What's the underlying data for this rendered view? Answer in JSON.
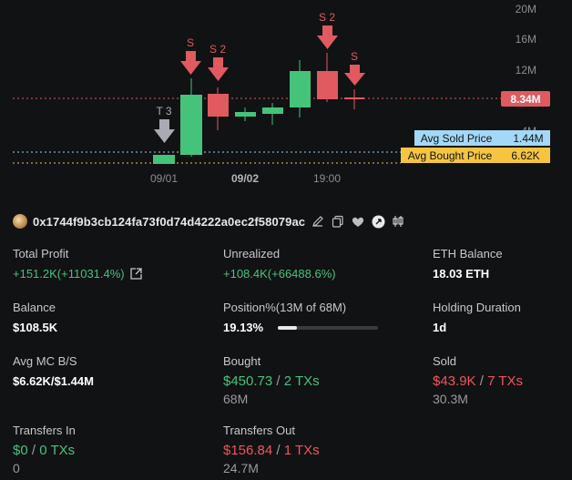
{
  "chart": {
    "y_ticks": [
      "20M",
      "16M",
      "12M",
      "8M",
      "4M"
    ],
    "x_ticks": [
      "09/01",
      "09/02",
      "19:00"
    ],
    "price_tag": "8.34M",
    "avg_sold": {
      "label": "Avg Sold Price",
      "value": "1.44M"
    },
    "avg_bought": {
      "label": "Avg Bought Price",
      "value": "6.62K"
    },
    "markers": [
      {
        "label": "T 3",
        "kind": "transfer"
      },
      {
        "label": "S",
        "kind": "sell"
      },
      {
        "label": "S 2",
        "kind": "sell"
      },
      {
        "label": "S 2",
        "kind": "sell"
      },
      {
        "label": "S",
        "kind": "sell"
      }
    ],
    "colors": {
      "up": "#45c37a",
      "down": "#e05a5f",
      "transfer": "#a9abb3"
    }
  },
  "wallet": {
    "address": "0x1744f9b3cb124fa73f0d74d4222a0ec2f58079ac"
  },
  "stats": {
    "total_profit": {
      "label": "Total Profit",
      "value": "+151.2K(+11031.4%)"
    },
    "unrealized": {
      "label": "Unrealized",
      "value": "+108.4K(+66488.6%)"
    },
    "eth_balance": {
      "label": "ETH Balance",
      "value": "18.03 ETH"
    },
    "balance": {
      "label": "Balance",
      "value": "$108.5K"
    },
    "position": {
      "label": "Position%(13M of 68M)",
      "value": "19.13%",
      "fraction": 0.1913
    },
    "holding": {
      "label": "Holding Duration",
      "value": "1d"
    },
    "avg_mc": {
      "label": "Avg MC B/S",
      "value": "$6.62K/$1.44M"
    },
    "bought": {
      "label": "Bought",
      "amount": "$450.73",
      "sep": " / ",
      "txs": "2 TXs",
      "sub": "68M"
    },
    "sold": {
      "label": "Sold",
      "amount": "$43.9K",
      "sep": " / ",
      "txs": "7 TXs",
      "sub": "30.3M"
    },
    "transfers_in": {
      "label": "Transfers In",
      "amount": "$0",
      "sep": " / ",
      "txs": "0 TXs",
      "sub": "0"
    },
    "transfers_out": {
      "label": "Transfers Out",
      "amount": "$156.84",
      "sep": " / ",
      "txs": "1 TXs",
      "sub": "24.7M"
    }
  }
}
